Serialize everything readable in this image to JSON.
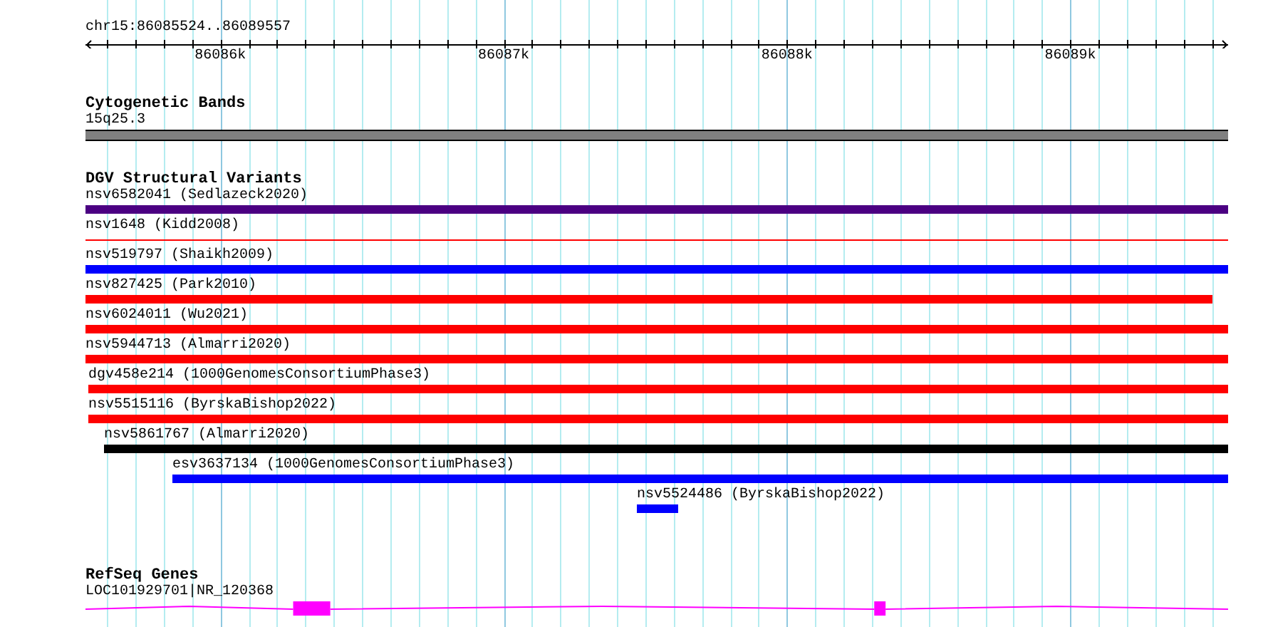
{
  "ruler": {
    "range_label": "chr15:86085524..86089557",
    "ticks": [
      {
        "label": "86086k"
      },
      {
        "label": "86087k"
      },
      {
        "label": "86088k"
      },
      {
        "label": "86089k"
      }
    ]
  },
  "cytogenetic_bands": {
    "title": "Cytogenetic Bands",
    "band": {
      "label": "15q25.3",
      "color": "#808080"
    }
  },
  "dgv_structural_variants": {
    "title": "DGV Structural Variants",
    "features": [
      {
        "label": "nsv6582041 (Sedlazeck2020)",
        "kind": "thick",
        "color": "#4b0082"
      },
      {
        "label": "nsv1648 (Kidd2008)",
        "kind": "thin",
        "color": "#ff0000"
      },
      {
        "label": "nsv519797 (Shaikh2009)",
        "kind": "thick",
        "color": "#0000ff"
      },
      {
        "label": "nsv827425 (Park2010)",
        "kind": "thick",
        "color": "#ff0000"
      },
      {
        "label": "nsv6024011 (Wu2021)",
        "kind": "thick",
        "color": "#ff0000"
      },
      {
        "label": "nsv5944713 (Almarri2020)",
        "kind": "thick",
        "color": "#ff0000"
      },
      {
        "label": "dgv458e214 (1000GenomesConsortiumPhase3)",
        "kind": "thick",
        "color": "#ff0000"
      },
      {
        "label": "nsv5515116 (ByrskaBishop2022)",
        "kind": "thick",
        "color": "#ff0000"
      },
      {
        "label": "nsv5861767 (Almarri2020)",
        "kind": "thick",
        "color": "#000000"
      },
      {
        "label": "esv3637134 (1000GenomesConsortiumPhase3)",
        "kind": "thick",
        "color": "#0000ff"
      },
      {
        "label": "nsv5524486 (ByrskaBishop2022)",
        "kind": "thick",
        "color": "#0000ff"
      }
    ]
  },
  "refseq_genes": {
    "title": "RefSeq Genes",
    "genes": [
      {
        "label": "LOC101929701|NR_120368",
        "color": "#ff00ff"
      }
    ]
  }
}
